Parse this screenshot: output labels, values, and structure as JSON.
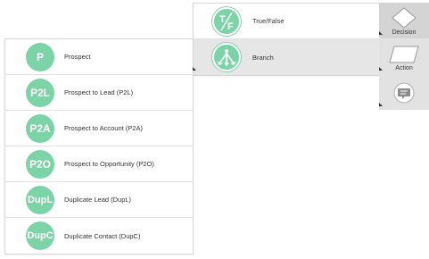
{
  "left_menu": {
    "items": [
      {
        "badge": "P",
        "label": "Prospect"
      },
      {
        "badge": "P2L",
        "label": "Prospect to Lead (P2L)"
      },
      {
        "badge": "P2A",
        "label": "Prospect to Account (P2A)"
      },
      {
        "badge": "P2O",
        "label": "Prospect to Opportunity (P2O)"
      },
      {
        "badge": "DupL",
        "label": "Duplicate Lead (DupL)"
      },
      {
        "badge": "DupC",
        "label": "Duplicate Contact (DupC)"
      }
    ]
  },
  "mid_menu": {
    "items": [
      {
        "icon": "true-false-icon",
        "label": "True/False"
      },
      {
        "icon": "branch-icon",
        "label": "Branch",
        "active": true
      }
    ]
  },
  "palette": {
    "tools": [
      {
        "icon": "diamond-icon",
        "label": "Decision"
      },
      {
        "icon": "parallelogram-icon",
        "label": "Action"
      },
      {
        "icon": "comment-icon",
        "label": ""
      }
    ]
  },
  "colors": {
    "badge": "#7dd3a8",
    "active_row": "#e6e6e6",
    "palette_bg": "#e2e2e2"
  }
}
